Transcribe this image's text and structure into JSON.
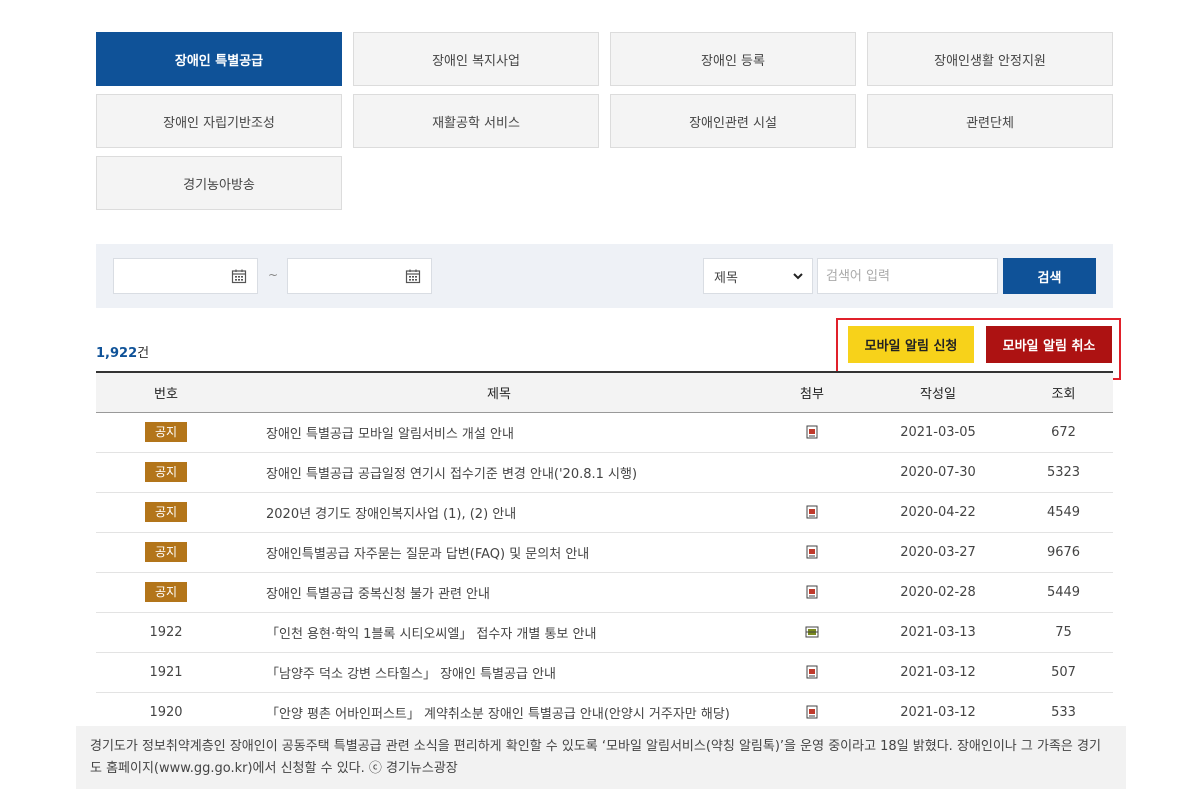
{
  "tabs": [
    {
      "label": "장애인 특별공급",
      "active": true
    },
    {
      "label": "장애인 복지사업",
      "active": false
    },
    {
      "label": "장애인 등록",
      "active": false
    },
    {
      "label": "장애인생활 안정지원",
      "active": false
    },
    {
      "label": "장애인 자립기반조성",
      "active": false
    },
    {
      "label": "재활공학 서비스",
      "active": false
    },
    {
      "label": "장애인관련 시설",
      "active": false
    },
    {
      "label": "관련단체",
      "active": false
    },
    {
      "label": "경기농아방송",
      "active": false
    }
  ],
  "search": {
    "date_separator": "~",
    "field_select": "제목",
    "keyword_placeholder": "검색어 입력",
    "button_label": "검색"
  },
  "result": {
    "count": "1,922",
    "unit": "건"
  },
  "alert_buttons": {
    "apply": "모바일 알림 신청",
    "cancel": "모바일 알림 취소"
  },
  "table": {
    "headers": {
      "no": "번호",
      "title": "제목",
      "attach": "첨부",
      "date": "작성일",
      "views": "조회"
    },
    "rows": [
      {
        "no": "",
        "badge": "공지",
        "title": "장애인 특별공급 모바일 알림서비스 개설 안내",
        "attach": "doc",
        "date": "2021-03-05",
        "views": "672"
      },
      {
        "no": "",
        "badge": "공지",
        "title": "장애인 특별공급 공급일정 연기시 접수기준 변경 안내('20.8.1 시행)",
        "attach": "",
        "date": "2020-07-30",
        "views": "5323"
      },
      {
        "no": "",
        "badge": "공지",
        "title": "2020년 경기도 장애인복지사업 (1), (2) 안내",
        "attach": "doc",
        "date": "2020-04-22",
        "views": "4549"
      },
      {
        "no": "",
        "badge": "공지",
        "title": "장애인특별공급 자주묻는 질문과 답변(FAQ) 및 문의처 안내",
        "attach": "doc",
        "date": "2020-03-27",
        "views": "9676"
      },
      {
        "no": "",
        "badge": "공지",
        "title": "장애인 특별공급 중복신청 불가 관련 안내",
        "attach": "doc",
        "date": "2020-02-28",
        "views": "5449"
      },
      {
        "no": "1922",
        "badge": "",
        "title": "「인천 용현·학익 1블록 시티오씨엘」 접수자 개별 통보 안내",
        "attach": "xls",
        "date": "2021-03-13",
        "views": "75"
      },
      {
        "no": "1921",
        "badge": "",
        "title": "「남양주 덕소 강변 스타힐스」 장애인 특별공급 안내",
        "attach": "doc",
        "date": "2021-03-12",
        "views": "507"
      },
      {
        "no": "1920",
        "badge": "",
        "title": "「안양 평촌 어바인퍼스트」 계약취소분 장애인 특별공급 안내(안양시 거주자만 해당)",
        "attach": "doc",
        "date": "2021-03-12",
        "views": "533"
      }
    ]
  },
  "caption": "경기도가 정보취약계층인 장애인이 공동주택 특별공급 관련 소식을 편리하게 확인할 수 있도록 ‘모바일 알림서비스(약칭 알림톡)’을 운영 중이라고 18일 밝혔다. 장애인이나 그 가족은 경기도 홈페이지(www.gg.go.kr)에서 신청할 수 있다. ⓒ 경기뉴스광장",
  "colors": {
    "primary": "#0f5298",
    "badge": "#b3751a",
    "apply": "#f7d21a",
    "cancel": "#ad1212",
    "highlight": "#e0202a"
  }
}
